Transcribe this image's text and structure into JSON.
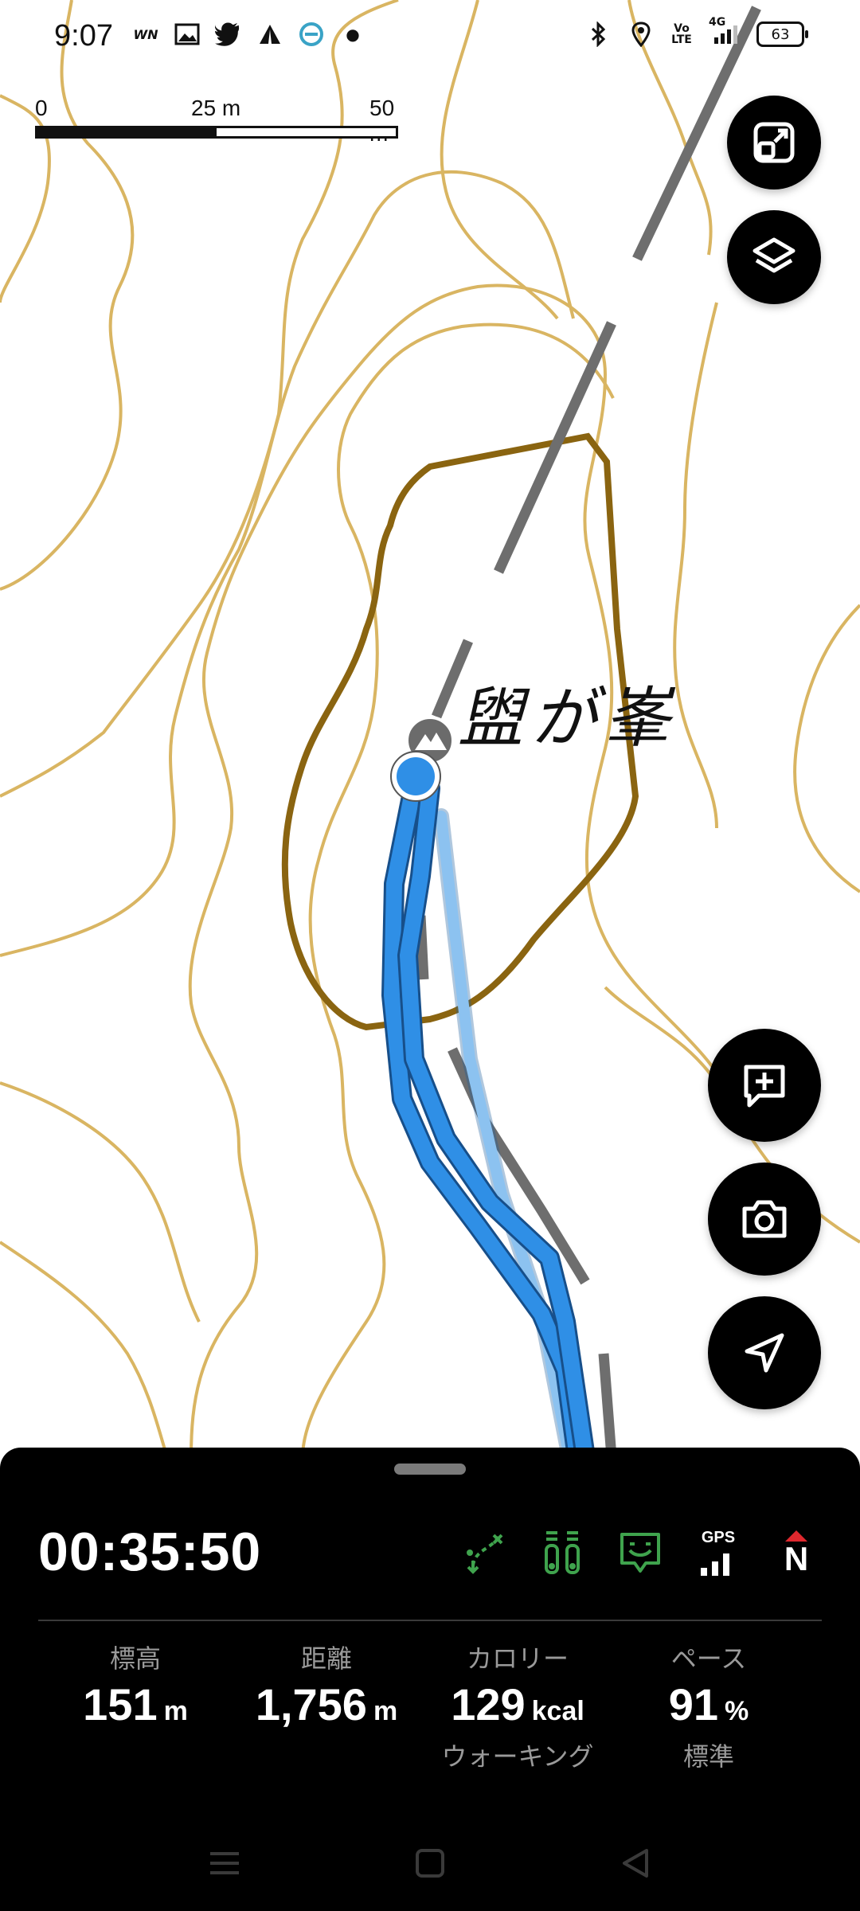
{
  "status_bar": {
    "time": "9:07",
    "left_icons": [
      "wn-news-icon",
      "image-icon",
      "twitter-icon",
      "triangle-app-icon",
      "s-app-icon",
      "dot-indicator"
    ],
    "right_icons": [
      "bluetooth-icon",
      "location-icon",
      "volte-icon",
      "4g-signal-icon",
      "battery-icon"
    ],
    "volte_text": "Vo LTE",
    "network_text": "4G",
    "battery": "63"
  },
  "scale_bar": {
    "labels": [
      "0",
      "25 m",
      "50 m"
    ]
  },
  "map": {
    "place_label": "盥が峯",
    "colors": {
      "contour": "#d9b562",
      "contour_index": "#8a6410",
      "path": "#6e6e6e",
      "track": "#2f8fe6",
      "track_faded": "#8cc2f0"
    }
  },
  "map_controls": {
    "fullscreen": "expand-icon",
    "layers": "layers-icon",
    "add_note": "add-note-icon",
    "camera": "camera-icon",
    "navigate": "navigation-arrow-icon"
  },
  "panel": {
    "timer": "00:35:50",
    "icons": [
      "route-icon",
      "altitude-icon",
      "face-icon",
      "gps-signal-icon",
      "compass-north-icon"
    ],
    "gps_label": "GPS",
    "compass_label": "N",
    "stats": [
      {
        "label": "標高",
        "value": "151",
        "unit": "m",
        "sub": ""
      },
      {
        "label": "距離",
        "value": "1,756",
        "unit": "m",
        "sub": ""
      },
      {
        "label": "カロリー",
        "value": "129",
        "unit": "kcal",
        "sub": "ウォーキング"
      },
      {
        "label": "ペース",
        "value": "91",
        "unit": "%",
        "sub": "標準"
      }
    ]
  },
  "nav_bar": {
    "buttons": [
      "menu-icon",
      "home-icon",
      "back-icon"
    ]
  }
}
